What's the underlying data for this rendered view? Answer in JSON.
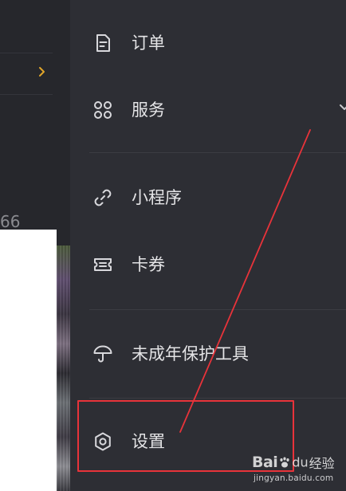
{
  "background_page": {
    "partial_count": "66"
  },
  "menu": {
    "items": [
      {
        "id": "orders",
        "label": "订单",
        "icon": "document-icon"
      },
      {
        "id": "services",
        "label": "服务",
        "icon": "grid-icon"
      },
      {
        "id": "mini_programs",
        "label": "小程序",
        "icon": "link-icon"
      },
      {
        "id": "coupons",
        "label": "卡券",
        "icon": "ticket-icon"
      },
      {
        "id": "minor_protection",
        "label": "未成年保护工具",
        "icon": "umbrella-icon"
      },
      {
        "id": "settings",
        "label": "设置",
        "icon": "gear-icon"
      }
    ]
  },
  "colors": {
    "drawer_background": "#2d2e34",
    "menu_text": "#e4e4e6",
    "icon_stroke": "#d8d8dc",
    "accent_chevron": "#e0a52a",
    "annotation_red": "#e8333a"
  },
  "watermark": {
    "brand": "Bai",
    "brand_suffix": "du",
    "product": "经验",
    "url": "jingyan.baidu.com"
  }
}
